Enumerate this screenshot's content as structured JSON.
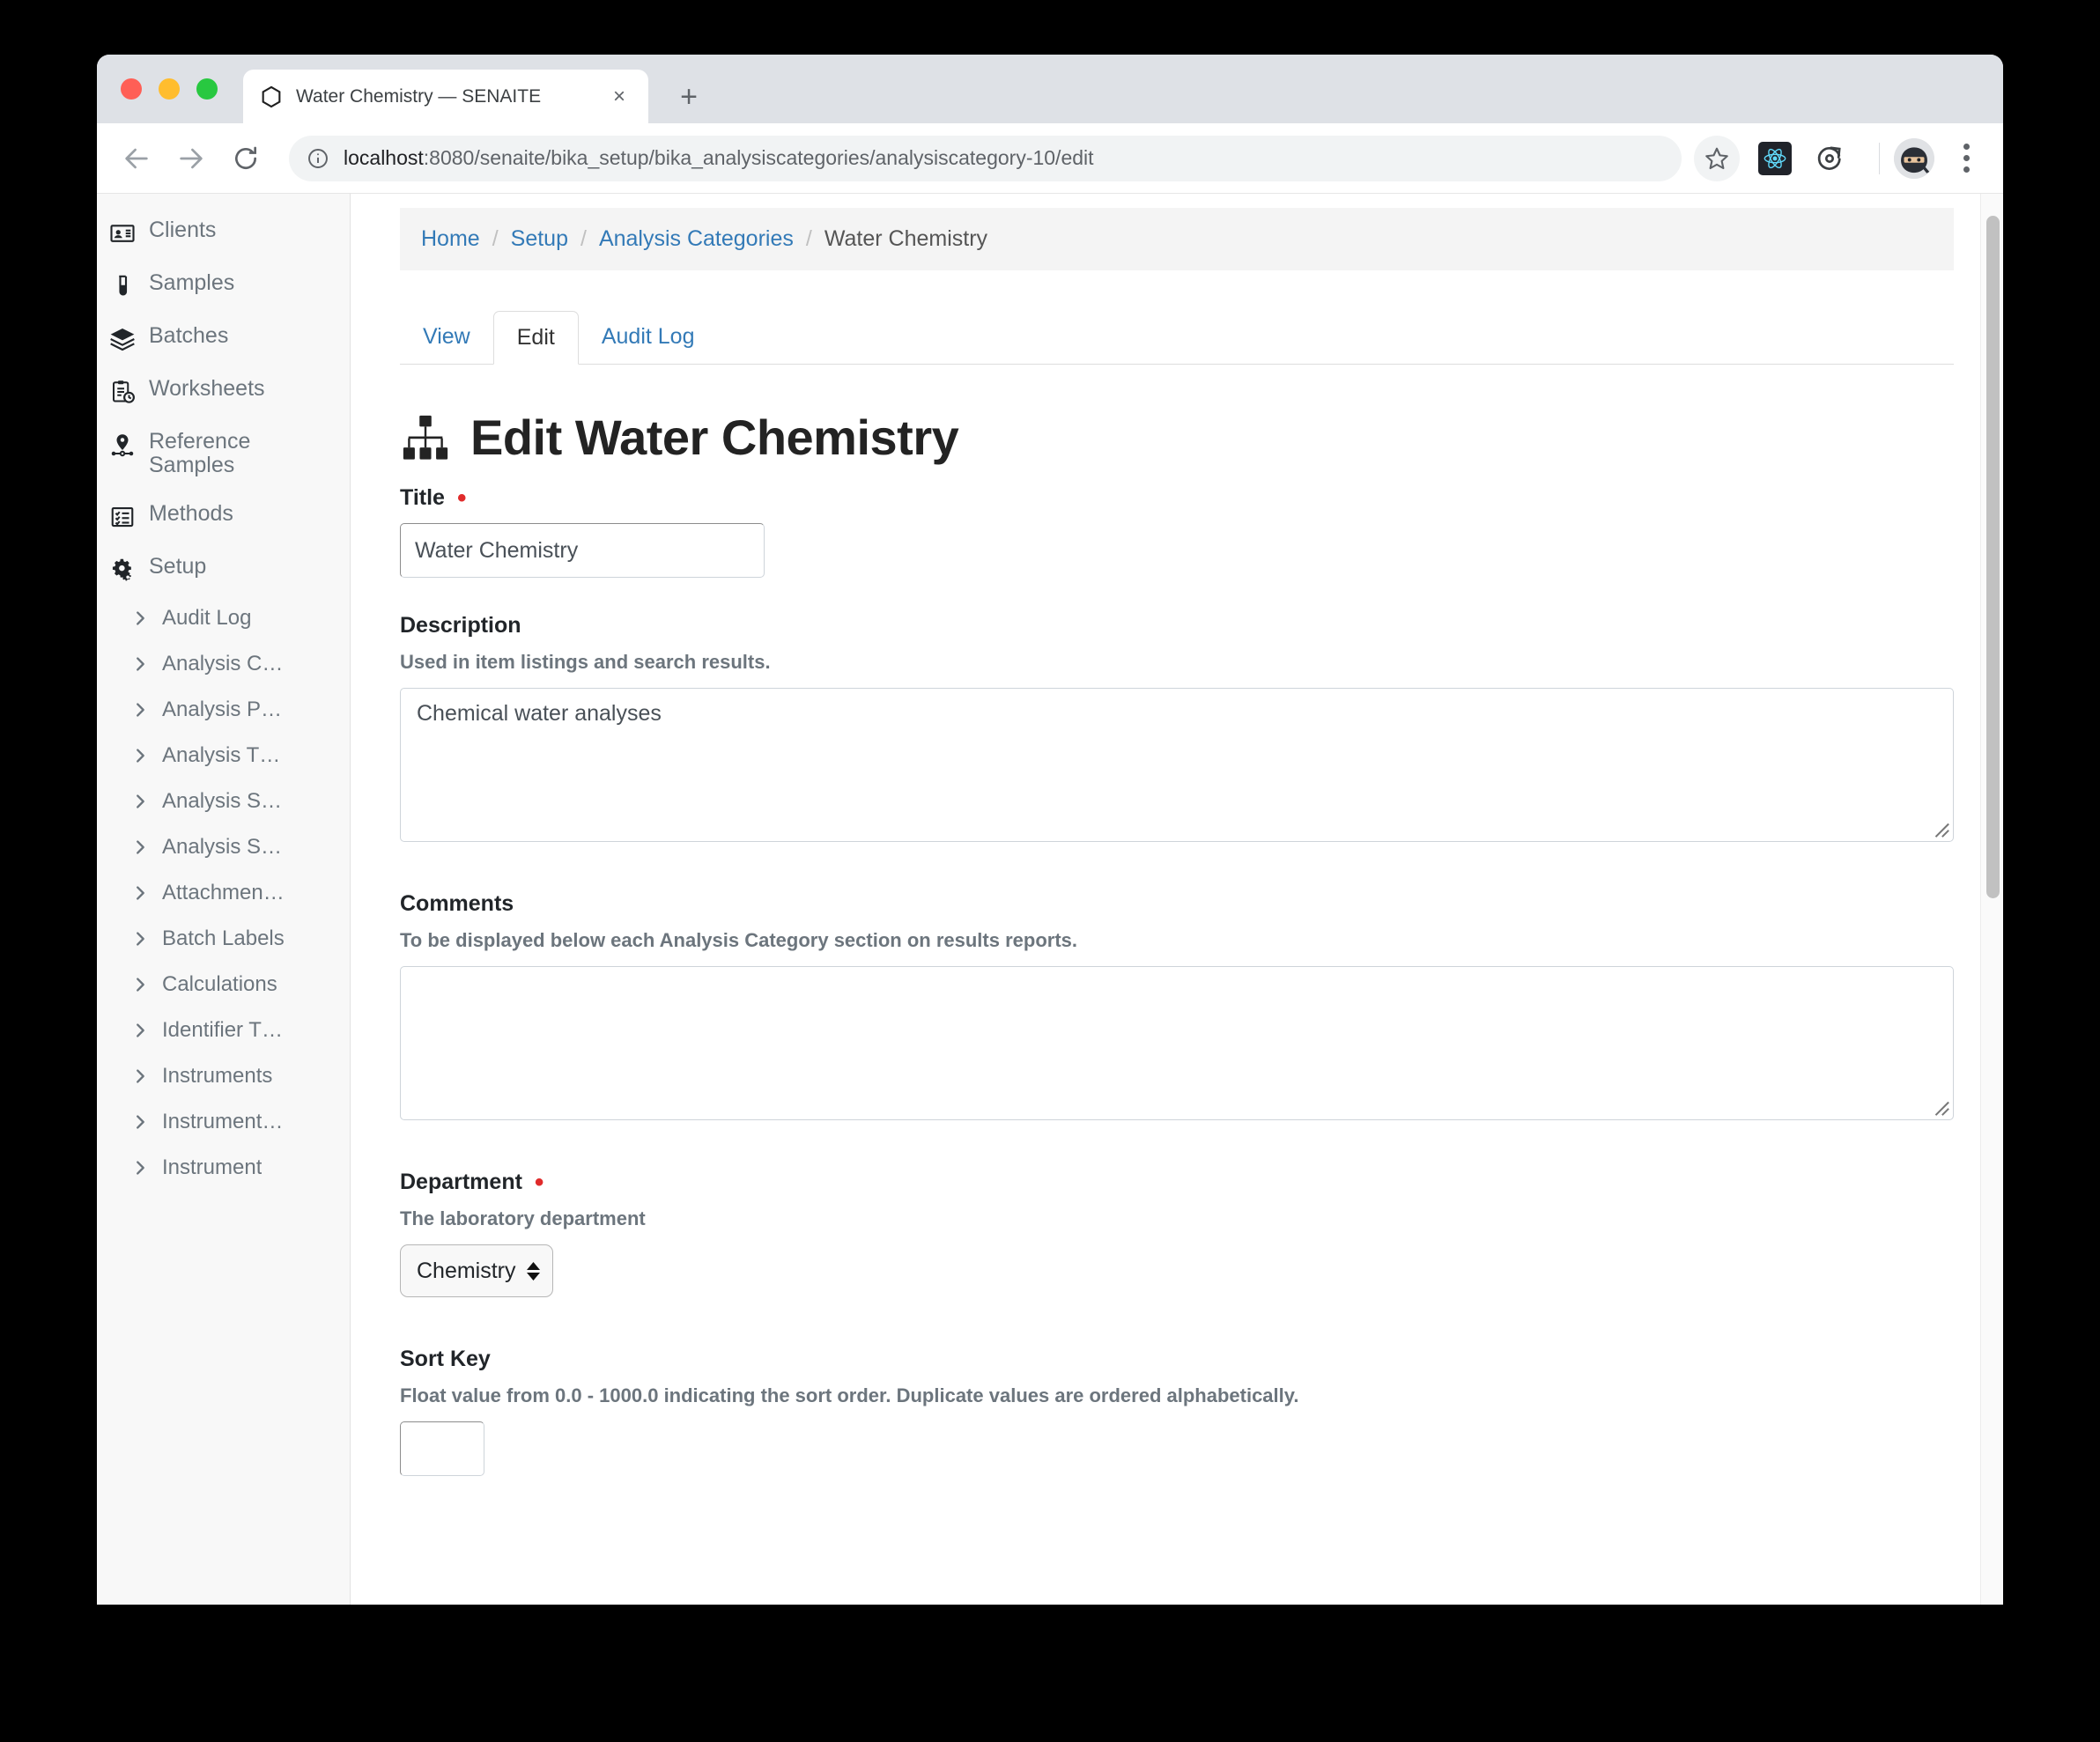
{
  "browser": {
    "tab": {
      "title": "Water Chemistry — SENAITE",
      "favicon": "hexagon-icon",
      "close": "×"
    },
    "new_tab_label": "+",
    "nav": {
      "back": "back-arrow-icon",
      "forward": "forward-arrow-icon",
      "reload": "reload-icon"
    },
    "omnibox": {
      "info_icon": "info-circle-icon",
      "host": "localhost",
      "rest": ":8080/senaite/bika_setup/bika_analysiscategories/analysiscategory-10/edit",
      "full_url": "localhost:8080/senaite/bika_setup/bika_analysiscategories/analysiscategory-10/edit"
    },
    "actions": {
      "bookmark": "star-icon",
      "extension_react": "react-devtools-icon",
      "extension_reload": "circular-arrow-icon",
      "profile": "ninja-avatar",
      "menu": "three-dot-menu-icon"
    }
  },
  "sidebar": {
    "items": [
      {
        "label": "Clients",
        "icon": "id-card-icon"
      },
      {
        "label": "Samples",
        "icon": "test-tube-icon"
      },
      {
        "label": "Batches",
        "icon": "layers-icon"
      },
      {
        "label": "Worksheets",
        "icon": "clipboard-clock-icon"
      },
      {
        "label": "Reference Samples",
        "icon": "map-pin-network-icon"
      },
      {
        "label": "Methods",
        "icon": "checklist-icon"
      },
      {
        "label": "Setup",
        "icon": "cogs-icon"
      }
    ],
    "sub_items": [
      {
        "label": "Audit Log"
      },
      {
        "label": "Analysis C…"
      },
      {
        "label": "Analysis P…"
      },
      {
        "label": "Analysis T…"
      },
      {
        "label": "Analysis S…"
      },
      {
        "label": "Analysis S…"
      },
      {
        "label": "Attachmen…"
      },
      {
        "label": "Batch Labels"
      },
      {
        "label": "Calculations"
      },
      {
        "label": "Identifier T…"
      },
      {
        "label": "Instruments"
      },
      {
        "label": "Instrument…"
      },
      {
        "label": "Instrument"
      }
    ]
  },
  "breadcrumb": {
    "home": "Home",
    "setup": "Setup",
    "categories": "Analysis Categories",
    "current": "Water Chemistry",
    "separator": "/"
  },
  "tabs": [
    {
      "label": "View",
      "active": false
    },
    {
      "label": "Edit",
      "active": true
    },
    {
      "label": "Audit Log",
      "active": false
    }
  ],
  "page": {
    "icon": "sitemap-icon",
    "title": "Edit Water Chemistry"
  },
  "form": {
    "title_field": {
      "label": "Title",
      "required_marker": "•",
      "value": "Water Chemistry",
      "placeholder": ""
    },
    "description_field": {
      "label": "Description",
      "help": "Used in item listings and search results.",
      "value": "Chemical water analyses",
      "placeholder": ""
    },
    "comments_field": {
      "label": "Comments",
      "help": "To be displayed below each Analysis Category section on results reports.",
      "value": "",
      "placeholder": ""
    },
    "department_field": {
      "label": "Department",
      "required_marker": "•",
      "help": "The laboratory department",
      "selected": "Chemistry"
    },
    "sortkey_field": {
      "label": "Sort Key",
      "help": "Float value from 0.0 - 1000.0 indicating the sort order. Duplicate values are ordered alphabetically.",
      "value": "",
      "placeholder": ""
    }
  },
  "colors": {
    "link": "#337ab7",
    "required": "#e02b2b",
    "sidebar_bg": "#f8f8f8",
    "breadcrumb_bg": "#f4f4f4",
    "chrome_tabstrip": "#dee1e6"
  }
}
